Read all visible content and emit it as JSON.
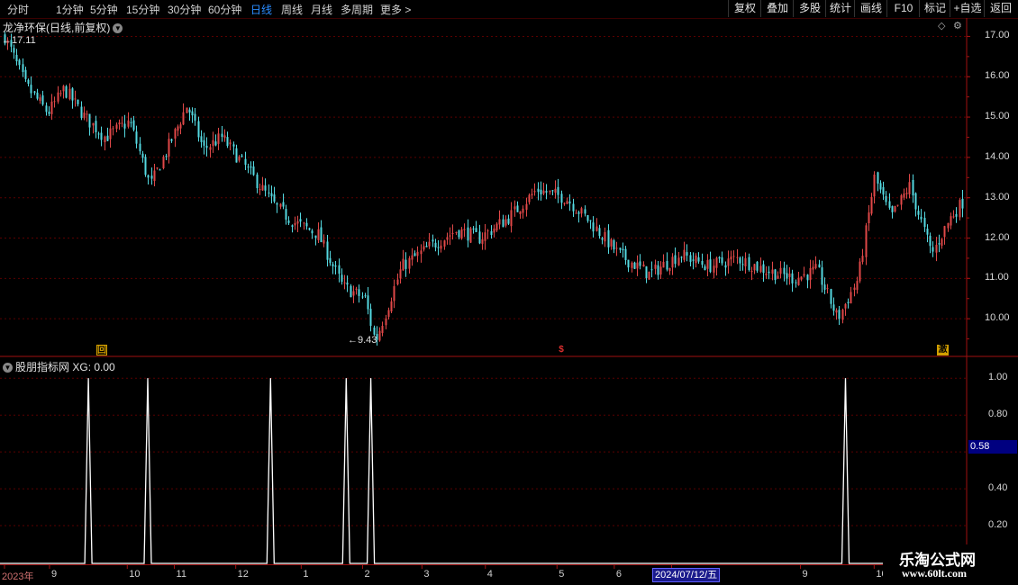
{
  "toolbar": {
    "periods": [
      "分时",
      "1分钟",
      "5分钟",
      "15分钟",
      "30分钟",
      "60分钟",
      "日线",
      "周线",
      "月线",
      "多周期",
      "更多"
    ],
    "active_period": "日线",
    "buttons": [
      "复权",
      "叠加",
      "多股",
      "统计",
      "画线",
      "F10",
      "标记",
      "+自选",
      "返回"
    ]
  },
  "main": {
    "title": "龙净环保(日线,前复权)",
    "high_label": "17.11",
    "low_label": "9.43",
    "markers": [
      {
        "text": "回",
        "color": "#d4a000"
      },
      {
        "text": "$",
        "color": "#e03030"
      },
      {
        "text": "激",
        "color": "#d4a000"
      }
    ]
  },
  "indicator": {
    "title": "股朋指标网",
    "value_text": "XG: 0.00",
    "current_value": "0.58",
    "signal_dates": [
      "2023-09-20",
      "2023-10-19",
      "2023-12-18",
      "2024-01-24",
      "2024-02-05",
      "2024-09-24"
    ]
  },
  "xaxis": {
    "labels": [
      "2023年",
      "9",
      "10",
      "11",
      "12",
      "1",
      "2",
      "3",
      "4",
      "5",
      "6",
      "7",
      "9",
      "10",
      "11"
    ],
    "cursor_date": "2024/07/12/五"
  },
  "watermark": {
    "line1": "乐淘公式网",
    "line2": "www.60lt.com"
  },
  "colors": {
    "up": "#e04848",
    "down": "#54d8e0",
    "accent": "#2a8cff",
    "grid": "#5a0000"
  },
  "chart_data": [
    {
      "type": "candlestick",
      "title": "龙净环保(日线,前复权)",
      "ylim": [
        9.2,
        17.3
      ],
      "yticks": [
        "17.00",
        "16.00",
        "15.00",
        "14.00",
        "13.00",
        "12.00",
        "11.00",
        "10.00"
      ],
      "x_start": "2023-08-10",
      "x_end": "2024-11-20",
      "high": 17.11,
      "low": 9.43,
      "close_path": [
        [
          "2023-08-10",
          17.0
        ],
        [
          "2023-08-20",
          15.8
        ],
        [
          "2023-08-31",
          15.1
        ],
        [
          "2023-09-08",
          15.7
        ],
        [
          "2023-09-18",
          15.0
        ],
        [
          "2023-09-28",
          14.5
        ],
        [
          "2023-10-10",
          14.9
        ],
        [
          "2023-10-20",
          13.3
        ],
        [
          "2023-11-01",
          14.6
        ],
        [
          "2023-11-07",
          15.3
        ],
        [
          "2023-11-15",
          14.2
        ],
        [
          "2023-11-24",
          14.5
        ],
        [
          "2023-12-08",
          13.6
        ],
        [
          "2023-12-20",
          12.8
        ],
        [
          "2023-12-29",
          12.4
        ],
        [
          "2024-01-10",
          12.1
        ],
        [
          "2024-01-22",
          10.8
        ],
        [
          "2024-02-02",
          10.5
        ],
        [
          "2024-02-07",
          9.43
        ],
        [
          "2024-02-20",
          11.3
        ],
        [
          "2024-03-05",
          11.8
        ],
        [
          "2024-03-18",
          12.2
        ],
        [
          "2024-03-29",
          12.0
        ],
        [
          "2024-04-12",
          12.5
        ],
        [
          "2024-04-26",
          13.2
        ],
        [
          "2024-05-10",
          13.0
        ],
        [
          "2024-05-22",
          12.4
        ],
        [
          "2024-06-05",
          11.6
        ],
        [
          "2024-06-20",
          11.1
        ],
        [
          "2024-07-05",
          11.6
        ],
        [
          "2024-07-19",
          11.3
        ],
        [
          "2024-08-02",
          11.5
        ],
        [
          "2024-08-16",
          11.2
        ],
        [
          "2024-08-30",
          11.0
        ],
        [
          "2024-09-10",
          11.2
        ],
        [
          "2024-09-20",
          10.0
        ],
        [
          "2024-09-30",
          11.0
        ],
        [
          "2024-10-08",
          13.5
        ],
        [
          "2024-10-16",
          12.5
        ],
        [
          "2024-10-25",
          13.3
        ],
        [
          "2024-11-05",
          11.6
        ],
        [
          "2024-11-14",
          12.5
        ],
        [
          "2024-11-20",
          12.9
        ]
      ]
    },
    {
      "type": "line",
      "title": "股朋指标网",
      "ylim": [
        0,
        1.05
      ],
      "yticks": [
        "1.00",
        "0.80",
        "0.40",
        "0.20"
      ],
      "series": [
        {
          "name": "XG",
          "values": [
            0,
            1,
            0,
            1,
            0,
            1,
            0,
            1,
            0,
            1,
            0,
            1,
            0
          ]
        }
      ]
    }
  ]
}
